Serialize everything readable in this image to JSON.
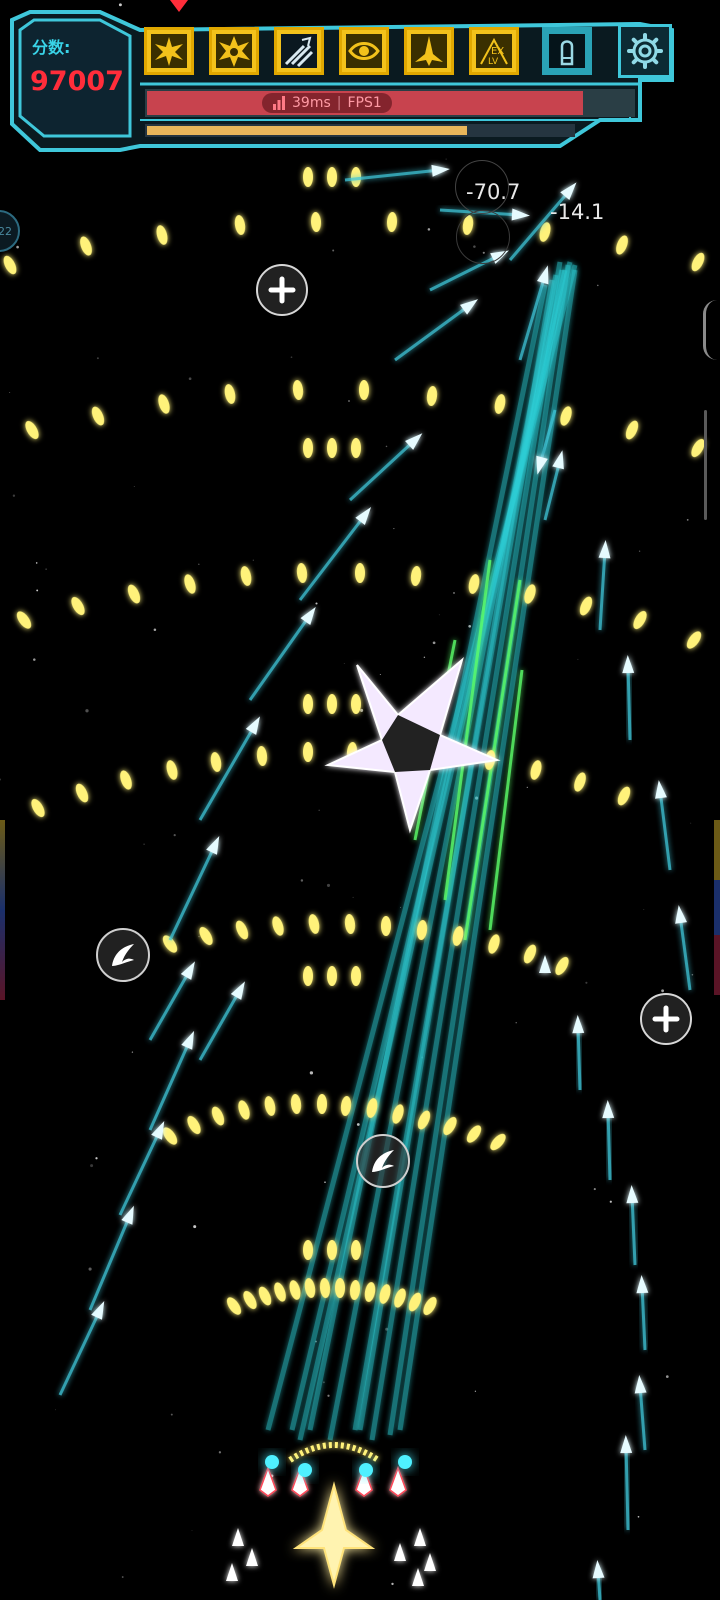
{
  "hud": {
    "score_label": "分数:",
    "score_value": "97007",
    "ping": "39ms",
    "fps": "FPS1",
    "hp_fraction": 0.89,
    "xp_fraction": 0.75,
    "skills": [
      {
        "icon": "burst-icon",
        "color": "yellow"
      },
      {
        "icon": "explosion-icon",
        "color": "yellow"
      },
      {
        "icon": "missile-barrage-icon",
        "color": "yellow"
      },
      {
        "icon": "radar-eye-icon",
        "color": "yellow"
      },
      {
        "icon": "jet-fighter-icon",
        "color": "yellow"
      },
      {
        "icon": "ex-level-icon",
        "color": "yellow"
      },
      {
        "icon": "bullet-icon",
        "color": "teal"
      }
    ],
    "settings_icon": "gear-icon"
  },
  "left_orb_text": "22",
  "damage_numbers": [
    "-70.7",
    "-14.1"
  ],
  "powerups": [
    {
      "type": "plus-icon"
    },
    {
      "type": "plus-icon"
    },
    {
      "type": "claw-icon"
    },
    {
      "type": "claw-icon"
    }
  ],
  "colors": {
    "hud_frame": "#3fc7da",
    "score": "#ff2d3a",
    "skill_bg": "#f3c21b",
    "hp_bar": "#c8434e",
    "xp_bar": "#e8b65a",
    "enemy_bullet": "#fff27a",
    "player_missile": "#3fc7da",
    "laser": "#2fd0d8",
    "laser_green": "#5cff6a",
    "boss_star": "#ffffff"
  }
}
